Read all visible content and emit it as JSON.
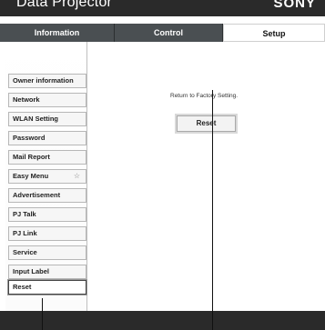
{
  "header": {
    "title": "Data Projector",
    "brand": "SONY"
  },
  "tabs": [
    {
      "label": "Information",
      "active": false
    },
    {
      "label": "Control",
      "active": false
    },
    {
      "label": "Setup",
      "active": true
    }
  ],
  "sidebar": {
    "items": [
      {
        "label": "Owner information"
      },
      {
        "label": "Network"
      },
      {
        "label": "WLAN Setting"
      },
      {
        "label": "Password"
      },
      {
        "label": "Mail Report"
      },
      {
        "label": "Easy Menu",
        "marker": "☆"
      },
      {
        "label": "Advertisement"
      },
      {
        "label": "PJ Talk"
      },
      {
        "label": "PJ Link"
      },
      {
        "label": "Service"
      },
      {
        "label": "Input Label"
      },
      {
        "label": "Reset",
        "selected": true
      }
    ]
  },
  "main": {
    "factory_setting_text": "Return to Factory Setting.",
    "reset_button_label": "Reset"
  },
  "colors": {
    "header_bg": "#2a2a2a",
    "tab_bg": "#4a4f52",
    "tab_active_bg": "#ffffff"
  }
}
